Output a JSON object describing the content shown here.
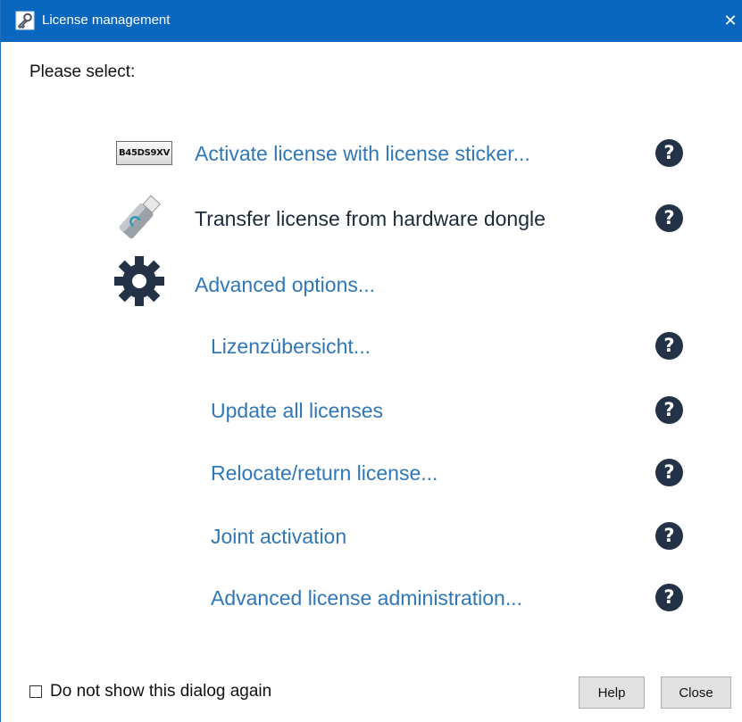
{
  "window": {
    "title": "License management",
    "close_glyph": "✕"
  },
  "prompt": "Please select:",
  "main_options": [
    {
      "label": "Activate license with license sticker...",
      "icon": "license-sticker-icon",
      "sticker_text": "B45DS9XV",
      "help": "?"
    },
    {
      "label": "Transfer license from hardware dongle",
      "icon": "usb-dongle-icon",
      "help": "?"
    },
    {
      "label": "Advanced options...",
      "icon": "gear-icon"
    }
  ],
  "advanced_options": [
    {
      "label": "Lizenzübersicht...",
      "help": "?"
    },
    {
      "label": "Update all licenses",
      "help": "?"
    },
    {
      "label": "Relocate/return license...",
      "help": "?"
    },
    {
      "label": "Joint activation",
      "help": "?"
    },
    {
      "label": "Advanced license administration...",
      "help": "?"
    }
  ],
  "footer": {
    "dont_show_label": "Do not show this dialog again",
    "help_button": "Help",
    "close_button": "Close"
  },
  "colors": {
    "titlebar": "#0a67c0",
    "link": "#2f77b7",
    "help_circle": "#233246"
  }
}
